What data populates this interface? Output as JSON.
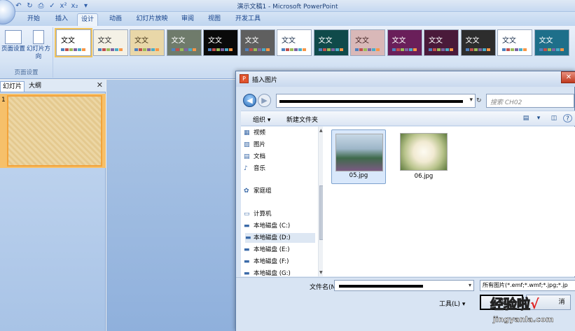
{
  "app": {
    "window_title": "演示文稿1 - Microsoft PowerPoint"
  },
  "ribbon": {
    "tabs": [
      {
        "label": "开始",
        "active": false
      },
      {
        "label": "插入",
        "active": false
      },
      {
        "label": "设计",
        "active": true
      },
      {
        "label": "动画",
        "active": false
      },
      {
        "label": "幻灯片放映",
        "active": false
      },
      {
        "label": "审阅",
        "active": false
      },
      {
        "label": "视图",
        "active": false
      },
      {
        "label": "开发工具",
        "active": false
      }
    ],
    "page_setup": {
      "page_setup_label": "页面设置",
      "orientation_label": "幻灯片方向",
      "group_label": "页面设置"
    },
    "theme_text": "文文",
    "themes": [
      {
        "bg": "#ffffff",
        "fg": "#000000"
      },
      {
        "bg": "#f4f1e6",
        "fg": "#333333"
      },
      {
        "bg": "#e9d7a8",
        "fg": "#4a3b1d"
      },
      {
        "bg": "#6f7b6b",
        "fg": "#ffffff"
      },
      {
        "bg": "#0a0a0a",
        "fg": "#ffffff"
      },
      {
        "bg": "#5f5f5f",
        "fg": "#ffffff"
      },
      {
        "bg": "#ffffff",
        "fg": "#1f3350"
      },
      {
        "bg": "#0f4a4a",
        "fg": "#ffffff"
      },
      {
        "bg": "#d9b8b8",
        "fg": "#4a2a2a"
      },
      {
        "bg": "#6a1f5a",
        "fg": "#ffffff"
      },
      {
        "bg": "#4a1a3a",
        "fg": "#ffffff"
      },
      {
        "bg": "#2d2d2d",
        "fg": "#ffffff"
      },
      {
        "bg": "#ffffff",
        "fg": "#1f3350"
      },
      {
        "bg": "#1e6f8a",
        "fg": "#ffffff"
      }
    ]
  },
  "slide_pane": {
    "tab_slides": "幻灯片",
    "tab_outline": "大纲",
    "close": "✕",
    "slide_number": "1"
  },
  "dialog": {
    "title": "插入图片",
    "close": "✕",
    "search_placeholder": "搜索 CH02",
    "toolbar": {
      "organize": "组织 ▾",
      "new_folder": "新建文件夹",
      "help": "?"
    },
    "nav_items": [
      {
        "label": "视频",
        "icon": "video-icon"
      },
      {
        "label": "图片",
        "icon": "pictures-icon"
      },
      {
        "label": "文档",
        "icon": "documents-icon"
      },
      {
        "label": "音乐",
        "icon": "music-icon"
      },
      {
        "label": "家庭组",
        "icon": "homegroup-icon"
      },
      {
        "label": "计算机",
        "icon": "computer-icon"
      },
      {
        "label": "本地磁盘 (C:)",
        "icon": "drive-icon"
      },
      {
        "label": "本地磁盘 (D:)",
        "icon": "drive-icon"
      },
      {
        "label": "本地磁盘 (E:)",
        "icon": "drive-icon"
      },
      {
        "label": "本地磁盘 (F:)",
        "icon": "drive-icon"
      },
      {
        "label": "本地磁盘 (G:)",
        "icon": "drive-icon"
      }
    ],
    "files": [
      {
        "name": "05.jpg",
        "selected": true
      },
      {
        "name": "06.jpg",
        "selected": false
      }
    ],
    "filename_label": "文件名(N):",
    "filter_value": "所有图片(*.emf;*.wmf;*.jpg;*.jp",
    "tools_label": "工具(L)",
    "insert_label": "插",
    "cancel_label": "消"
  },
  "watermark": {
    "text": "经验啦",
    "check": "√",
    "url": "jingyanla.com"
  }
}
